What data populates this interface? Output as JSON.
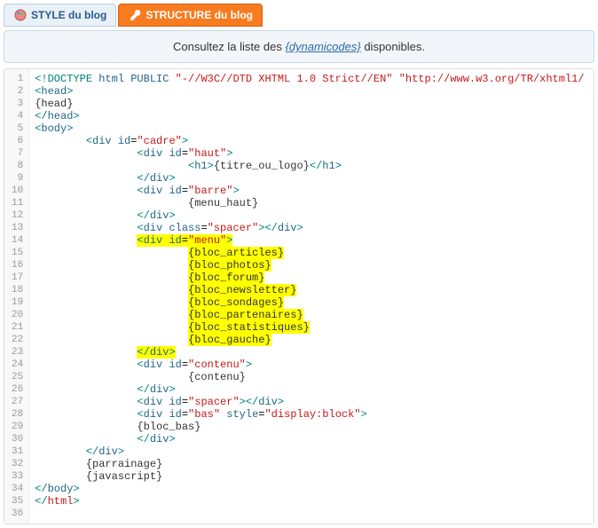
{
  "tabs": {
    "style": "STYLE du blog",
    "structure": "STRUCTURE du blog"
  },
  "notice": {
    "prefix": "Consultez la liste des ",
    "link": "{dynamicodes}",
    "suffix": " disponibles."
  },
  "code": {
    "lines": [
      {
        "n": 1,
        "indent": 0,
        "t": "doctype",
        "text": "<!DOCTYPE html PUBLIC \"-//W3C//DTD XHTML 1.0 Strict//EN\" \"http://www.w3.org/TR/xhtml1/"
      },
      {
        "n": 2,
        "indent": 0,
        "t": "open",
        "tag": "head"
      },
      {
        "n": 3,
        "indent": 0,
        "t": "text",
        "text": "{head}"
      },
      {
        "n": 4,
        "indent": 0,
        "t": "close",
        "tag": "head"
      },
      {
        "n": 5,
        "indent": 0,
        "t": "open",
        "tag": "body"
      },
      {
        "n": 6,
        "indent": 8,
        "t": "open",
        "tag": "div",
        "attr": "id",
        "val": "cadre"
      },
      {
        "n": 7,
        "indent": 16,
        "t": "open",
        "tag": "div",
        "attr": "id",
        "val": "haut"
      },
      {
        "n": 8,
        "indent": 24,
        "t": "wrap",
        "otag": "h1",
        "text": "{titre_ou_logo}",
        "ctag": "h1"
      },
      {
        "n": 9,
        "indent": 16,
        "t": "close",
        "tag": "div"
      },
      {
        "n": 10,
        "indent": 16,
        "t": "open",
        "tag": "div",
        "attr": "id",
        "val": "barre"
      },
      {
        "n": 11,
        "indent": 24,
        "t": "text",
        "text": "{menu_haut}"
      },
      {
        "n": 12,
        "indent": 16,
        "t": "close",
        "tag": "div"
      },
      {
        "n": 13,
        "indent": 16,
        "t": "openclose",
        "tag": "div",
        "attr": "class",
        "val": "spacer"
      },
      {
        "n": 14,
        "indent": 16,
        "t": "open",
        "tag": "div",
        "attr": "id",
        "val": "menu",
        "hl": true
      },
      {
        "n": 15,
        "indent": 24,
        "t": "text",
        "text": "{bloc_articles}",
        "hl": true
      },
      {
        "n": 16,
        "indent": 24,
        "t": "text",
        "text": "{bloc_photos}",
        "hl": true
      },
      {
        "n": 17,
        "indent": 24,
        "t": "text",
        "text": "{bloc_forum}",
        "hl": true
      },
      {
        "n": 18,
        "indent": 24,
        "t": "text",
        "text": "{bloc_newsletter}",
        "hl": true
      },
      {
        "n": 19,
        "indent": 24,
        "t": "text",
        "text": "{bloc_sondages}",
        "hl": true
      },
      {
        "n": 20,
        "indent": 24,
        "t": "text",
        "text": "{bloc_partenaires}",
        "hl": true
      },
      {
        "n": 21,
        "indent": 24,
        "t": "text",
        "text": "{bloc_statistiques}",
        "hl": true
      },
      {
        "n": 22,
        "indent": 24,
        "t": "text",
        "text": "{bloc_gauche}",
        "hl": true
      },
      {
        "n": 23,
        "indent": 16,
        "t": "close",
        "tag": "div",
        "hl": true
      },
      {
        "n": 24,
        "indent": 16,
        "t": "open",
        "tag": "div",
        "attr": "id",
        "val": "contenu"
      },
      {
        "n": 25,
        "indent": 24,
        "t": "text",
        "text": "{contenu}"
      },
      {
        "n": 26,
        "indent": 16,
        "t": "close",
        "tag": "div"
      },
      {
        "n": 27,
        "indent": 16,
        "t": "openclose",
        "tag": "div",
        "attr": "id",
        "val": "spacer"
      },
      {
        "n": 28,
        "indent": 16,
        "t": "open",
        "tag": "div",
        "attr": "id",
        "val": "bas",
        "attr2": "style",
        "val2": "display:block"
      },
      {
        "n": 29,
        "indent": 16,
        "t": "text",
        "text": "{bloc_bas}"
      },
      {
        "n": 30,
        "indent": 16,
        "t": "close",
        "tag": "div"
      },
      {
        "n": 31,
        "indent": 8,
        "t": "close",
        "tag": "div"
      },
      {
        "n": 32,
        "indent": 8,
        "t": "text",
        "text": "{parrainage}"
      },
      {
        "n": 33,
        "indent": 8,
        "t": "text",
        "text": "{javascript}"
      },
      {
        "n": 34,
        "indent": 0,
        "t": "close",
        "tag": "body"
      },
      {
        "n": 35,
        "indent": 0,
        "t": "close",
        "tag": "html",
        "red": true
      },
      {
        "n": 36,
        "indent": 0,
        "t": "empty"
      }
    ]
  }
}
